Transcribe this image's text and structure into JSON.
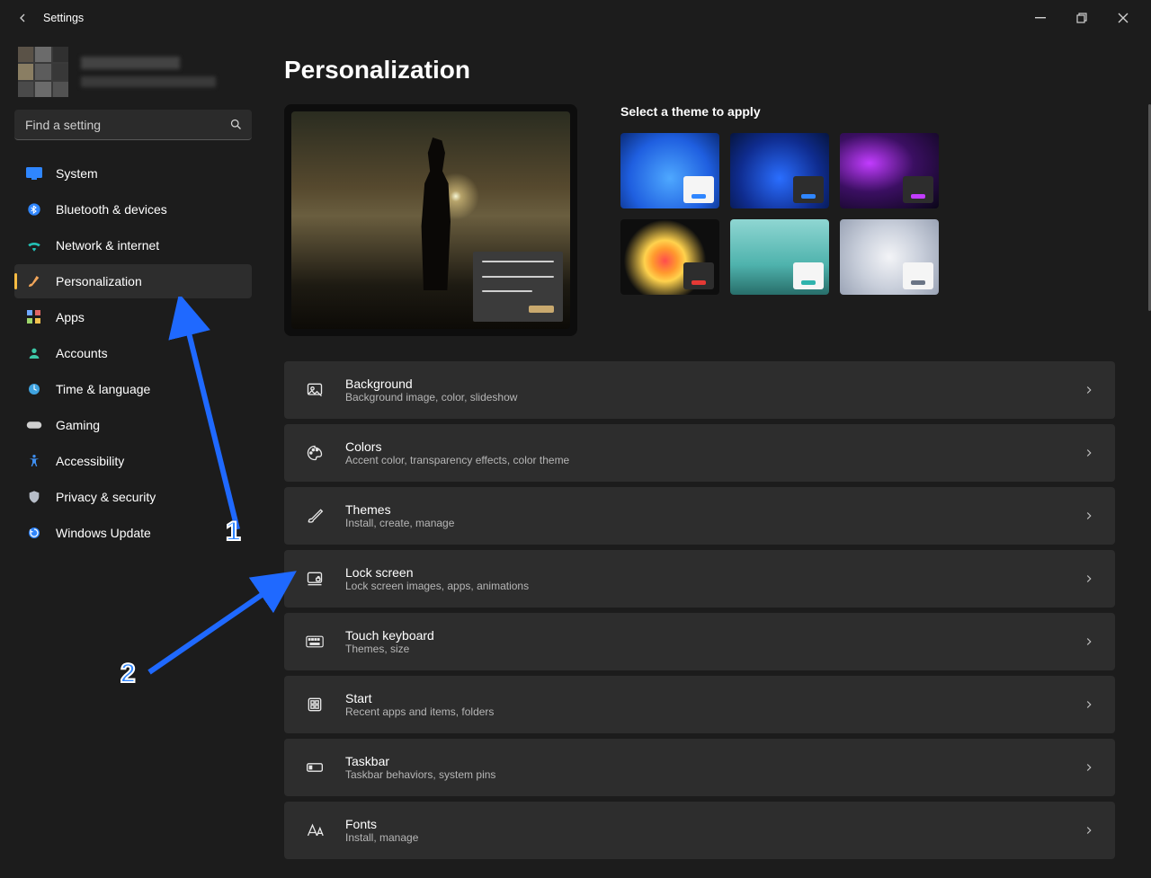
{
  "titlebar": {
    "appTitle": "Settings"
  },
  "search": {
    "placeholder": "Find a setting"
  },
  "nav": {
    "items": [
      {
        "label": "System"
      },
      {
        "label": "Bluetooth & devices"
      },
      {
        "label": "Network & internet"
      },
      {
        "label": "Personalization",
        "active": true
      },
      {
        "label": "Apps"
      },
      {
        "label": "Accounts"
      },
      {
        "label": "Time & language"
      },
      {
        "label": "Gaming"
      },
      {
        "label": "Accessibility"
      },
      {
        "label": "Privacy & security"
      },
      {
        "label": "Windows Update"
      }
    ]
  },
  "page": {
    "title": "Personalization",
    "themesHeader": "Select a theme to apply",
    "themes": [
      {
        "bg": "radial-gradient(circle at 50% 60%, #4ea8ff 0%, #1f5fe0 60%, #0a2b78 100%)",
        "swatchDark": false,
        "dash": "#2f86ff"
      },
      {
        "bg": "radial-gradient(circle at 50% 60%, #2a6eff 0%, #0f2c8f 60%, #06153f 100%)",
        "swatchDark": true,
        "dash": "#2f86ff"
      },
      {
        "bg": "radial-gradient(ellipse at 30% 40%, #c23cff 0%, #3b0f62 45%, #0a0618 100%)",
        "swatchDark": true,
        "dash": "#c23cff"
      },
      {
        "bg": "radial-gradient(circle at 45% 55%, #ff4d4d 0%, #ff9a2e 18%, #ffd24d 30%, #0e0e0e 60%)",
        "swatchDark": true,
        "dash": "#e53935"
      },
      {
        "bg": "linear-gradient(to bottom, #8fd6d2 0%, #4fb3ad 60%, #286e6a 100%)",
        "swatchDark": false,
        "dash": "#2fb3ad"
      },
      {
        "bg": "radial-gradient(circle at 50% 50%, #f3f4f7 0%, #c9cfdb 50%, #9aa3b5 100%)",
        "swatchDark": false,
        "dash": "#6a7485"
      }
    ],
    "cards": [
      {
        "title": "Background",
        "desc": "Background image, color, slideshow"
      },
      {
        "title": "Colors",
        "desc": "Accent color, transparency effects, color theme"
      },
      {
        "title": "Themes",
        "desc": "Install, create, manage"
      },
      {
        "title": "Lock screen",
        "desc": "Lock screen images, apps, animations"
      },
      {
        "title": "Touch keyboard",
        "desc": "Themes, size"
      },
      {
        "title": "Start",
        "desc": "Recent apps and items, folders"
      },
      {
        "title": "Taskbar",
        "desc": "Taskbar behaviors, system pins"
      },
      {
        "title": "Fonts",
        "desc": "Install, manage"
      }
    ]
  },
  "annotations": {
    "num1": "1",
    "num2": "2"
  }
}
